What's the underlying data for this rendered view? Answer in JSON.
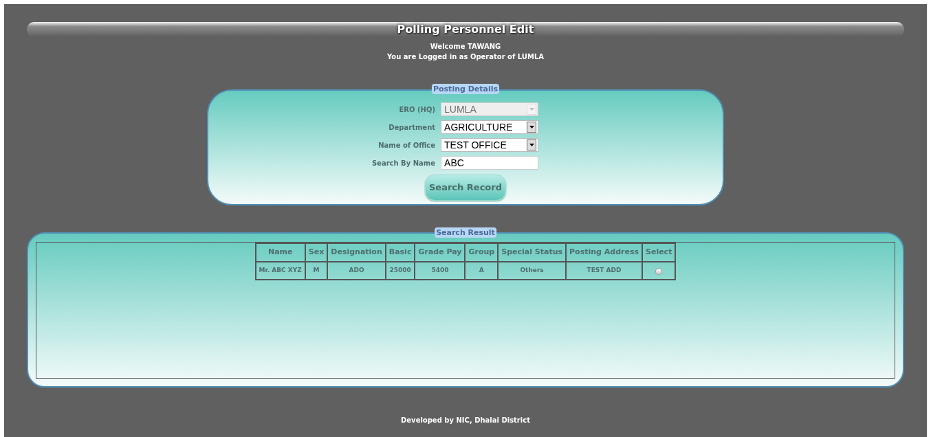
{
  "header": {
    "title": "Polling Personnel Edit",
    "welcome": "Welcome TAWANG",
    "login_info": "You are Logged in as Operator of LUMLA"
  },
  "posting_details": {
    "legend": "Posting Details",
    "fields": [
      {
        "label": "ERO (HQ)",
        "kind": "select",
        "value": "LUMLA",
        "disabled": true
      },
      {
        "label": "Department",
        "kind": "select",
        "value": "AGRICULTURE",
        "disabled": false
      },
      {
        "label": "Name of Office",
        "kind": "select",
        "value": "TEST OFFICE",
        "disabled": false
      },
      {
        "label": "Search By Name",
        "kind": "text",
        "value": "ABC",
        "disabled": false
      }
    ],
    "button": "Search Record"
  },
  "search_result": {
    "legend": "Search Result",
    "columns": [
      "Name",
      "Sex",
      "Designation",
      "Basic",
      "Grade Pay",
      "Group",
      "Special Status",
      "Posting Address",
      "Select"
    ],
    "rows": [
      {
        "cells": [
          "Mr. ABC XYZ",
          "M",
          "ADO",
          "25000",
          "5400",
          "A",
          "Others",
          "TEST ADD"
        ],
        "selected": false
      }
    ]
  },
  "footer": "Developed by NIC, Dhalai District"
}
